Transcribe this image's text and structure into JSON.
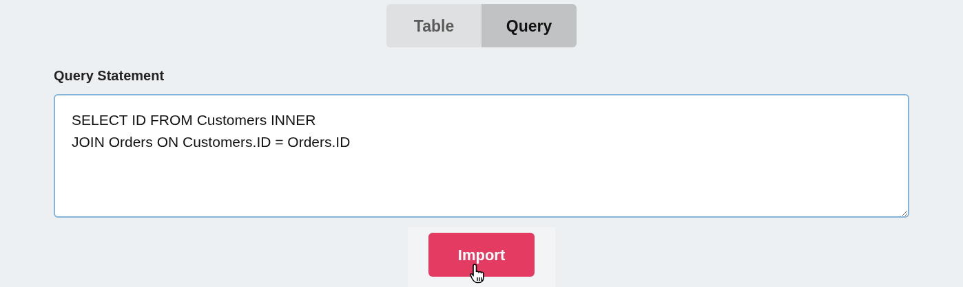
{
  "tabs": [
    {
      "label": "Table",
      "selected": false
    },
    {
      "label": "Query",
      "selected": true
    }
  ],
  "query_field": {
    "label": "Query Statement",
    "value": "SELECT ID FROM Customers INNER\nJOIN Orders ON Customers.ID = Orders.ID"
  },
  "import_button": {
    "label": "Import"
  }
}
